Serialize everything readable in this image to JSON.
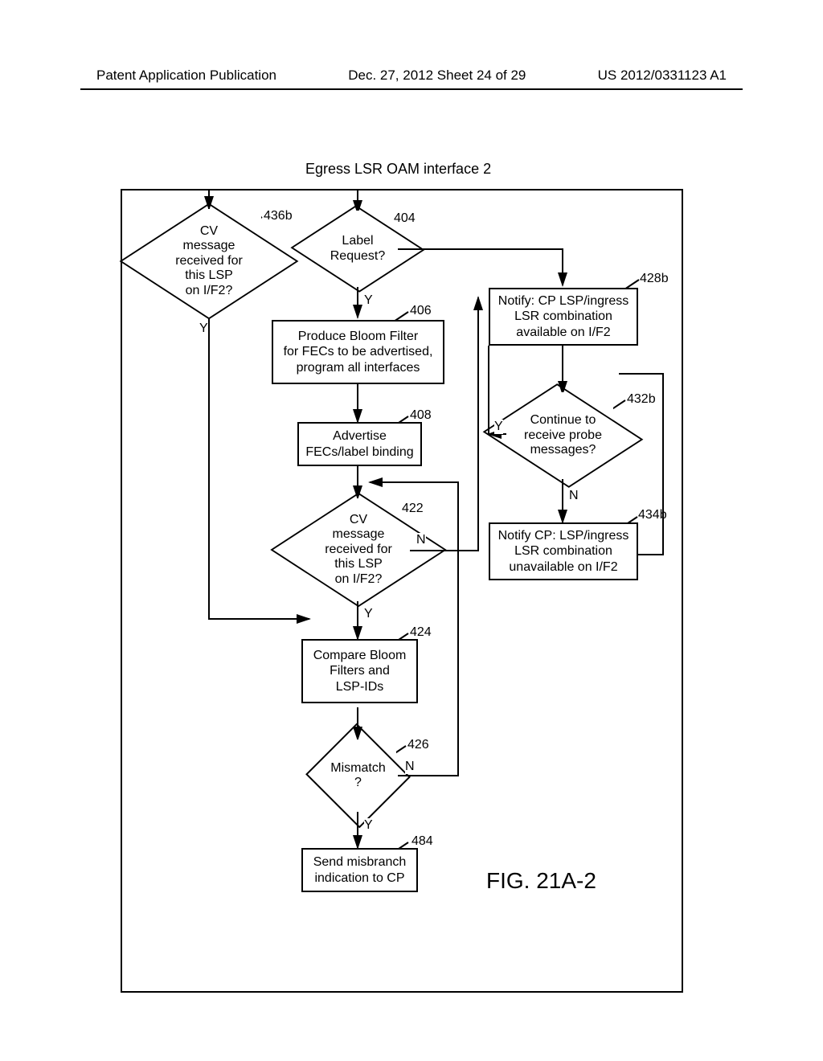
{
  "header": {
    "left": "Patent Application Publication",
    "center": "Dec. 27, 2012  Sheet 24 of 29",
    "right": "US 2012/0331123 A1"
  },
  "diagram": {
    "title": "Egress LSR OAM interface 2",
    "fig_label": "FIG. 21A-2",
    "nodes": {
      "d404": {
        "text": "Label\nRequest?",
        "ref": "404"
      },
      "r406": {
        "text": "Produce Bloom Filter\nfor FECs to be advertised,\nprogram all interfaces",
        "ref": "406"
      },
      "r408": {
        "text": "Advertise\nFECs/label binding",
        "ref": "408"
      },
      "d422": {
        "text": "CV\nmessage\nreceived for\nthis LSP\non I/F2?",
        "ref": "422"
      },
      "r424": {
        "text": "Compare Bloom\nFilters and\nLSP-IDs",
        "ref": "424"
      },
      "d426": {
        "text": "Mismatch\n?",
        "ref": "426"
      },
      "r484": {
        "text": "Send misbranch\nindication to CP",
        "ref": "484"
      },
      "r428b": {
        "text": "Notify: CP LSP/ingress\nLSR combination\navailable on I/F2",
        "ref": "428b"
      },
      "d432b": {
        "text": "Continue to\nreceive probe\nmessages?",
        "ref": "432b"
      },
      "r434b": {
        "text": "Notify CP: LSP/ingress\nLSR combination\nunavailable on I/F2",
        "ref": "434b"
      },
      "d436b": {
        "text": "CV\nmessage\nreceived for\nthis LSP\non I/F2?",
        "ref": "436b"
      }
    },
    "edge_labels": {
      "y1": "Y",
      "y2": "Y",
      "y3": "Y",
      "y4": "Y",
      "y5": "Y",
      "n1": "N",
      "n2": "N",
      "n3": "N"
    }
  }
}
